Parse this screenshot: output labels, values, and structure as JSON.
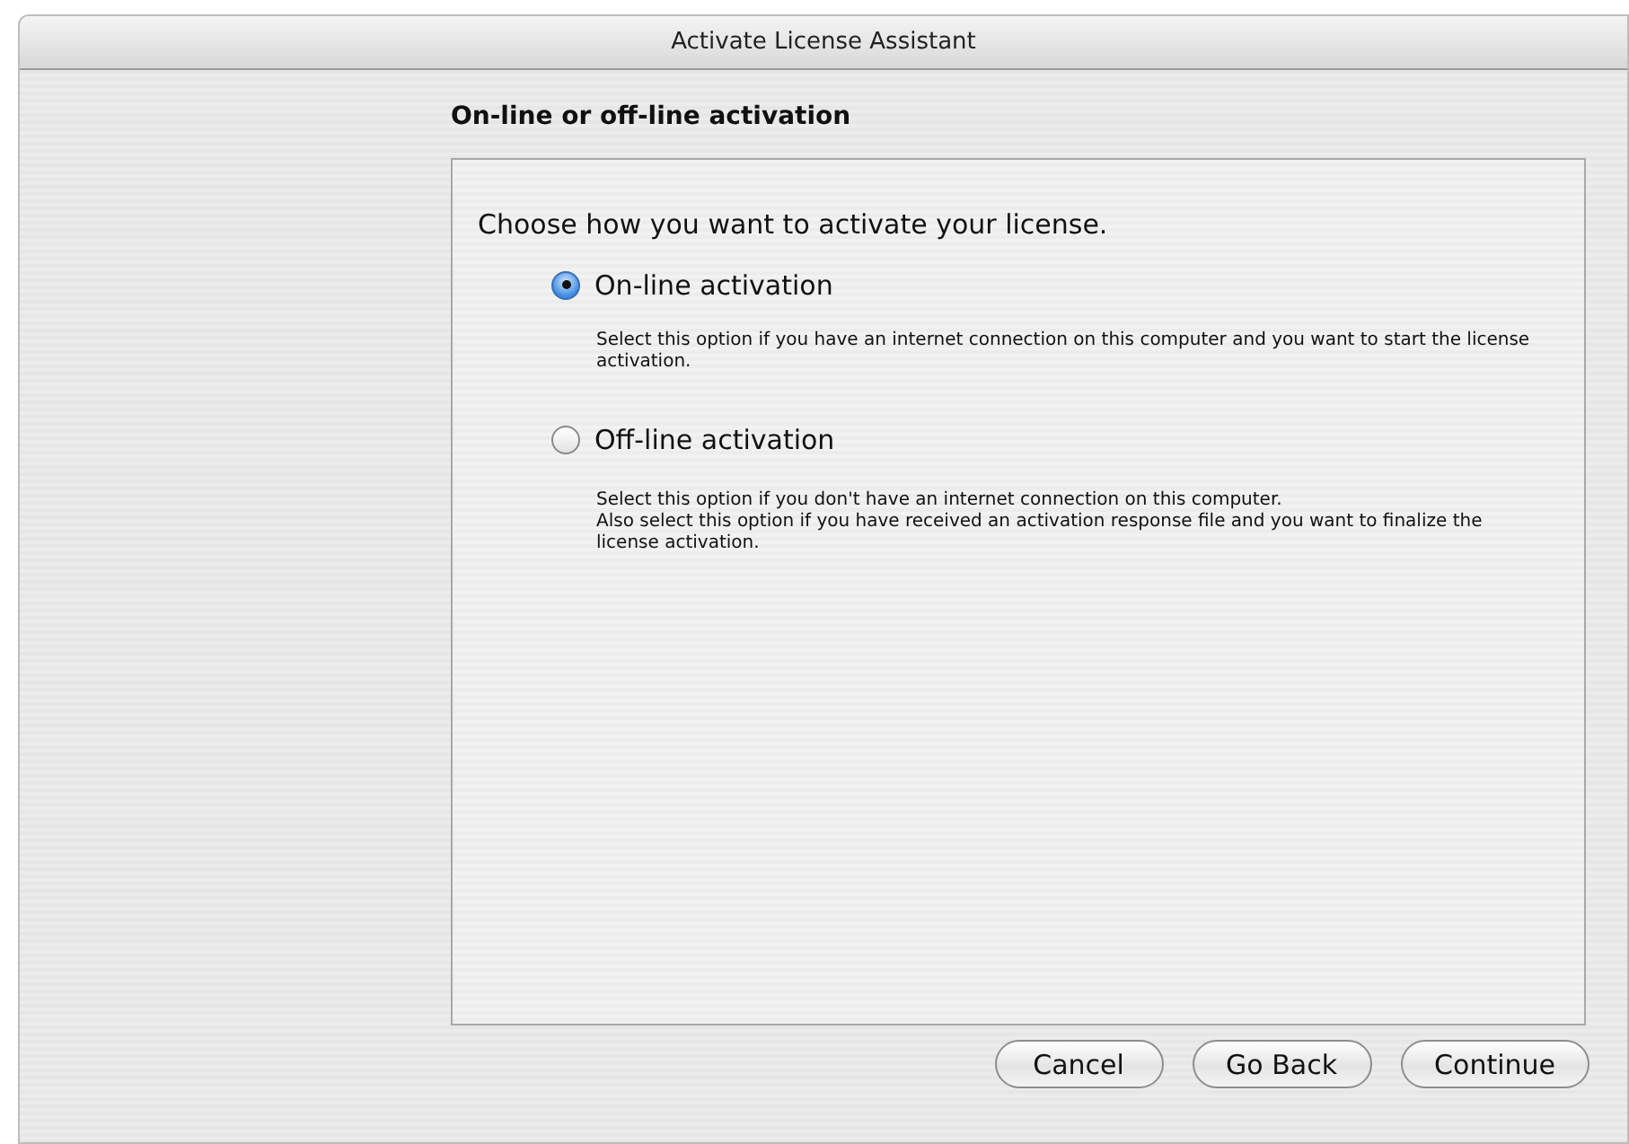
{
  "window": {
    "title": "Activate License Assistant"
  },
  "heading": "On-line or off-line activation",
  "prompt": "Choose how you want to activate your license.",
  "options": [
    {
      "label": "On-line activation",
      "selected": true,
      "description": [
        "Select this option if you have an internet connection on this computer and you want to start the license activation."
      ]
    },
    {
      "label": "Off-line activation",
      "selected": false,
      "description": [
        "Select this option if you don't have an internet connection on this computer.",
        "Also select this option if you have received an activation response file and you want to finalize the license activation."
      ]
    }
  ],
  "buttons": [
    "Cancel",
    "Go Back",
    "Continue"
  ]
}
